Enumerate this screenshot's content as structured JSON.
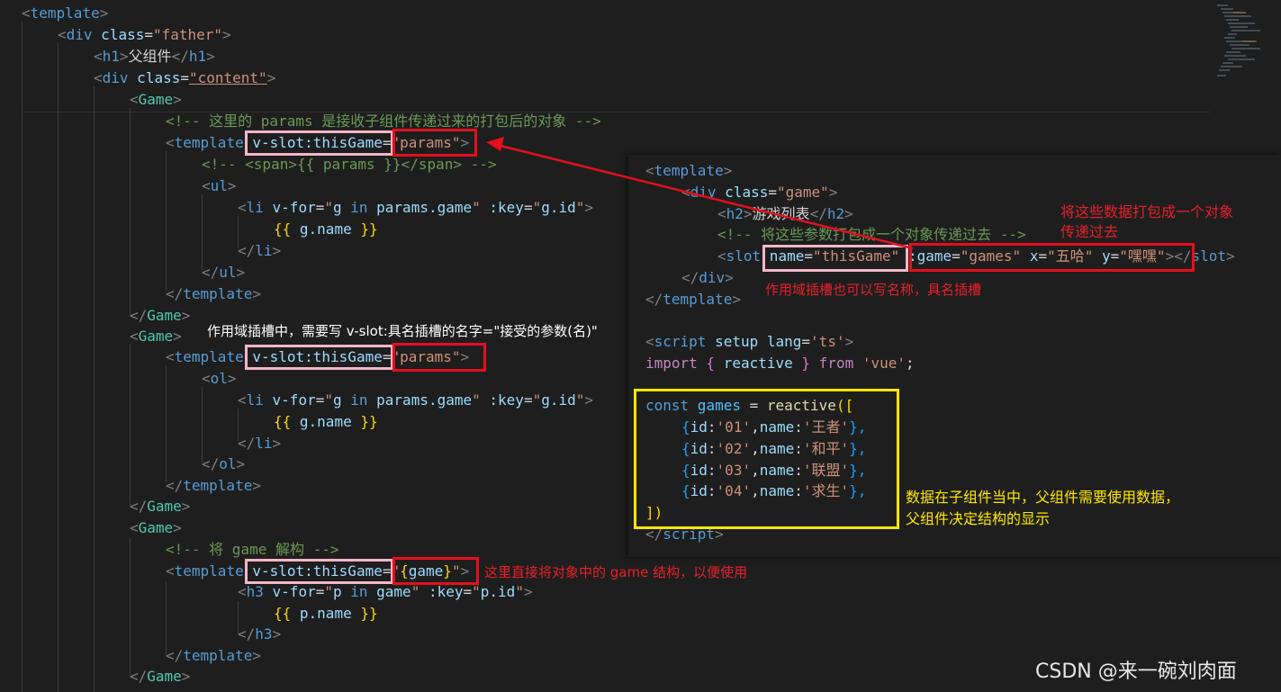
{
  "lines": [
    {
      "p1": "<",
      "t": "template",
      "p2": ">"
    },
    {
      "p1": "<",
      "t": "div",
      "a": " class",
      "eq": "=",
      "s": "\"father\"",
      "p2": ">"
    },
    {
      "p1": "<",
      "t": "h1",
      "p2": ">",
      "txt": "父组件",
      "p3": "</",
      "t2": "h1",
      "p4": ">"
    },
    {
      "p1": "<",
      "t": "div",
      "a": " class",
      "eq": "=",
      "s": "\"content\"",
      "p2": ">"
    },
    {
      "p1": "<",
      "t": "Game",
      "p2": ">"
    },
    {
      "c": "<!-- 这里的 params 是接收子组件传递过来的打包后的对象 -->"
    },
    {
      "p1": "<",
      "t": "template",
      "sp": " ",
      "a": "v-slot:thisGame",
      "eq": "=",
      "s": "\"params\"",
      "p2": ">"
    },
    {
      "c": "<!-- <span>{{ params }}</span> -->"
    },
    {
      "p1": "<",
      "t": "ul",
      "p2": ">"
    },
    {
      "p1": "<",
      "t": "li",
      "a": " v-for",
      "eq": "=",
      "s1": "\"",
      "a2": "g",
      "k": " in ",
      "a3": "params.game",
      "s2": "\"",
      "a4": " :key",
      "eq2": "=",
      "s3": "\"",
      "a5": "g.id",
      "s4": "\"",
      "p2": ">"
    },
    {
      "br1": "{{ ",
      "a": "g.name",
      "br2": " }}"
    },
    {
      "p1": "</",
      "t": "li",
      "p2": ">"
    },
    {
      "p1": "</",
      "t": "ul",
      "p2": ">"
    },
    {
      "p1": "</",
      "t": "template",
      "p2": ">"
    },
    {
      "p1": "</",
      "t": "Game",
      "p2": ">"
    },
    {
      "p1": "<",
      "t": "Game",
      "p2": ">"
    },
    {
      "p1": "<",
      "t": "template",
      "sp": " ",
      "a": "v-slot:thisGame",
      "eq": "=",
      "s": "\"params\"",
      "p2": ">"
    },
    {
      "p1": "<",
      "t": "ol",
      "p2": ">"
    },
    {
      "p1": "<",
      "t": "li",
      "a": " v-for",
      "eq": "=",
      "s1": "\"",
      "a2": "g",
      "k": " in ",
      "a3": "params.game",
      "s2": "\"",
      "a4": " :key",
      "eq2": "=",
      "s3": "\"",
      "a5": "g.id",
      "s4": "\"",
      "p2": ">"
    },
    {
      "br1": "{{ ",
      "a": "g.name",
      "br2": " }}"
    },
    {
      "p1": "</",
      "t": "li",
      "p2": ">"
    },
    {
      "p1": "</",
      "t": "ol",
      "p2": ">"
    },
    {
      "p1": "</",
      "t": "template",
      "p2": ">"
    },
    {
      "p1": "</",
      "t": "Game",
      "p2": ">"
    },
    {
      "p1": "<",
      "t": "Game",
      "p2": ">"
    },
    {
      "c": "<!-- 将 game 解构 -->"
    },
    {
      "p1": "<",
      "t": "template",
      "sp": " ",
      "a": "v-slot:thisGame",
      "eq": "=",
      "s1": "\"",
      "br1": "{",
      "a2": "game",
      "br2": "}",
      "s2": "\"",
      "p2": ">"
    },
    {
      "p1": "<",
      "t": "h3",
      "a": " v-for",
      "eq": "=",
      "s1": "\"",
      "a2": "p",
      "k": " in ",
      "a3": "game",
      "s2": "\"",
      "a4": " :key",
      "eq2": "=",
      "s3": "\"",
      "a5": "p.id",
      "s4": "\"",
      "p2": ">"
    },
    {
      "br1": "{{ ",
      "a": "p.name",
      "br2": " }}"
    },
    {
      "p1": "</",
      "t": "h3",
      "p2": ">"
    },
    {
      "p1": "</",
      "t": "template",
      "p2": ">"
    },
    {
      "p1": "</",
      "t": "Game",
      "p2": ">"
    }
  ],
  "panel": {
    "l1": {
      "p1": "<",
      "t": "template",
      "p2": ">"
    },
    "l2": {
      "p1": "<",
      "t": "div",
      "a": " class",
      "eq": "=",
      "s": "\"game\"",
      "p2": ">"
    },
    "l3": {
      "p1": "<",
      "t": "h2",
      "p2": ">",
      "txt": "游戏列表",
      "p3": "</",
      "t2": "h2",
      "p4": ">"
    },
    "l4": {
      "c": "<!-- 将这些参数打包成一个对象传递过去 -->"
    },
    "l5": {
      "p1": "<",
      "t": "slot",
      "a": " name",
      "eq": "=",
      "s": "\"thisGame\"",
      "a2": " :game",
      "eq2": "=",
      "s2": "\"games\"",
      "a3": " x",
      "eq3": "=",
      "s3": "\"五哈\"",
      "a4": " y",
      "eq4": "=",
      "s4": "\"嘿嘿\"",
      "p2": "></",
      "t2": "slot",
      "p3": ">"
    },
    "l6": {
      "p1": "</",
      "t": "div",
      "p2": ">"
    },
    "l7": {
      "p1": "</",
      "t": "template",
      "p2": ">"
    },
    "l8": {
      "p1": "<",
      "t": "script",
      "a": " setup lang",
      "eq": "=",
      "s": "'ts'",
      "p2": ">"
    },
    "l9": {
      "k": "import",
      "br1": " { ",
      "a": "reactive",
      "br2": " } ",
      "k2": "from",
      "s": " 'vue'",
      "w": ";"
    },
    "l10": {
      "t": "const",
      "a": " games",
      "w": " = ",
      "f": "reactive",
      "br": "(["
    },
    "rows": [
      {
        "b1": "{",
        "k1": "id",
        "c1": ":",
        "v1": "'01'",
        "cm": ",",
        "k2": "name",
        "c2": ":",
        "v2": "'王者'",
        "b2": "},"
      },
      {
        "b1": "{",
        "k1": "id",
        "c1": ":",
        "v1": "'02'",
        "cm": ",",
        "k2": "name",
        "c2": ":",
        "v2": "'和平'",
        "b2": "},"
      },
      {
        "b1": "{",
        "k1": "id",
        "c1": ":",
        "v1": "'03'",
        "cm": ",",
        "k2": "name",
        "c2": ":",
        "v2": "'联盟'",
        "b2": "},"
      },
      {
        "b1": "{",
        "k1": "id",
        "c1": ":",
        "v1": "'04'",
        "cm": ",",
        "k2": "name",
        "c2": ":",
        "v2": "'求生'",
        "b2": "},"
      }
    ],
    "l15": {
      "br": "])"
    },
    "l16": {
      "p1": "</",
      "t": "script",
      "p2": ">"
    }
  },
  "notes": {
    "pack_object": "将这些数据打包成一个对象\n传递过去",
    "named_slot": "作用域插槽也可以写名称，具名插槽",
    "scoped_slot_syntax": "作用域插槽中，需要写 v-slot:具名插槽的名字=\"接受的参数(名)\"",
    "destructure": "这里直接将对象中的 game 结构，以便使用",
    "data_in_child": "数据在子组件当中，父组件需要使用数据，\n父组件决定结构的显示"
  },
  "watermark": "CSDN @来一碗刘肉面",
  "colors": {
    "red": "#e3101c",
    "pink": "#f4b6c9",
    "yellow": "#ffe800"
  }
}
